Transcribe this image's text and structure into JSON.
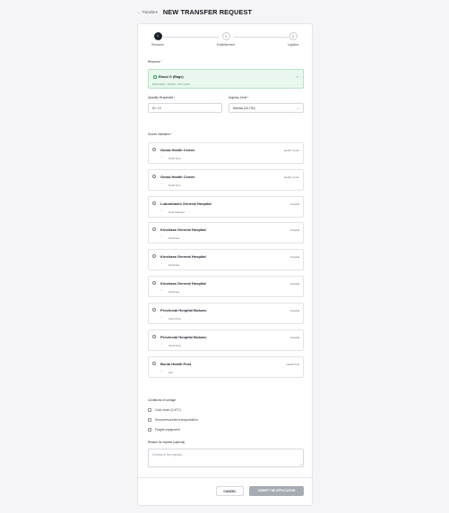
{
  "header": {
    "back_label": "← Transfers",
    "title": "NEW TRANSFER REQUEST"
  },
  "stepper": {
    "steps": [
      {
        "number": "1",
        "label": "Resource"
      },
      {
        "number": "2",
        "label": "Establishment"
      },
      {
        "number": "3",
        "label": "Logistics"
      }
    ]
  },
  "resource": {
    "label": "Resource",
    "required_mark": "*",
    "selected_title": "Blood O (Bags)",
    "selected_sub": "Disposable · Pocket · 30 in stock",
    "close_glyph": "×"
  },
  "quantity": {
    "label": "Quantity Requested",
    "required_mark": "*",
    "placeholder": "Ex: 10"
  },
  "urgency": {
    "label": "Urgency Level",
    "required_mark": "*",
    "value": "Normal (24-72h)",
    "chevron": "⌄"
  },
  "institutions": {
    "label": "Source Institution",
    "required_mark": "*",
    "pin_glyph": "⌖",
    "items": [
      {
        "name": "Goma Health Center",
        "type": "Health Center",
        "location": "North Kivu"
      },
      {
        "name": "Goma Health Center",
        "type": "Health Center",
        "location": "North Kivu"
      },
      {
        "name": "Lubumbashi General Hospital",
        "type": "Hospital",
        "location": "Haut-Katanga"
      },
      {
        "name": "Kinshasa General Hospital",
        "type": "Hospital",
        "location": "Kinshasa"
      },
      {
        "name": "Kinshasa General Hospital",
        "type": "Hospital",
        "location": "Kinshasa"
      },
      {
        "name": "Kinshasa General Hospital",
        "type": "Hospital",
        "location": "Kinshasa"
      },
      {
        "name": "Provincial Hospital Bukavu",
        "type": "Hospital",
        "location": "South Kivu"
      },
      {
        "name": "Provincial Hospital Bukavu",
        "type": "Hospital",
        "location": "South Kivu"
      },
      {
        "name": "Bunia Health Post",
        "type": "Health Post",
        "location": "Ituri"
      }
    ]
  },
  "carriage": {
    "label": "Conditions of carriage",
    "options": [
      "Cold chain (2-8°C)",
      "Secure/escorted transportation",
      "Fragile equipment"
    ]
  },
  "reason": {
    "label": "Reason for request (optional)",
    "placeholder": "Context of the request..."
  },
  "actions": {
    "cancel_label": "CANCEL",
    "submit_label": "SUBMIT THE APPLICATION"
  },
  "colors": {
    "accent_dark": "#1d212b",
    "selected_bg": "#e9f7ee",
    "submit_disabled": "#a7abb3"
  }
}
